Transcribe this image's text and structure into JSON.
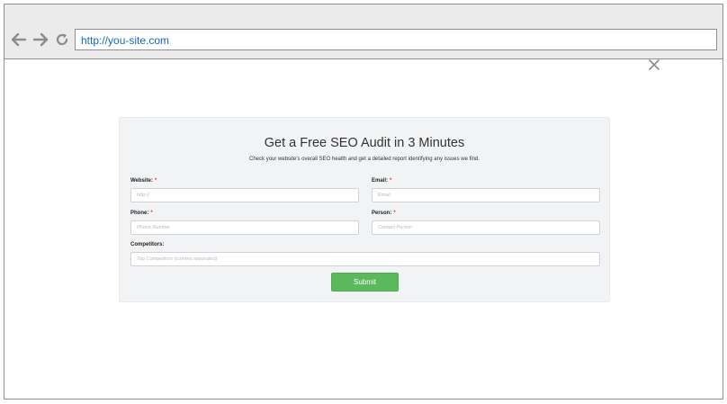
{
  "browser": {
    "url": "http://you-site.com",
    "icons": [
      "back-arrow-icon",
      "forward-arrow-icon",
      "reload-icon",
      "close-icon"
    ]
  },
  "form": {
    "title": "Get a Free SEO Audit in 3 Minutes",
    "subtitle": "Check your website's overall SEO health and get a detailed report identifying any issues we find.",
    "fields": {
      "website": {
        "label": "Website:",
        "required": "*",
        "placeholder": "http://"
      },
      "email": {
        "label": "Email:",
        "required": "*",
        "placeholder": "Email"
      },
      "phone": {
        "label": "Phone:",
        "required": "*",
        "placeholder": "Phone Number"
      },
      "person": {
        "label": "Person:",
        "required": "*",
        "placeholder": "Contact Person"
      },
      "competitors": {
        "label": "Competitors:",
        "placeholder": "Top Competitors (comma separated)"
      }
    },
    "submit_label": "Submit"
  },
  "colors": {
    "submit": "#5cb85c",
    "required_mark": "#e53935",
    "url_text": "#1565c0",
    "panel_bg": "#f2f3f4"
  }
}
